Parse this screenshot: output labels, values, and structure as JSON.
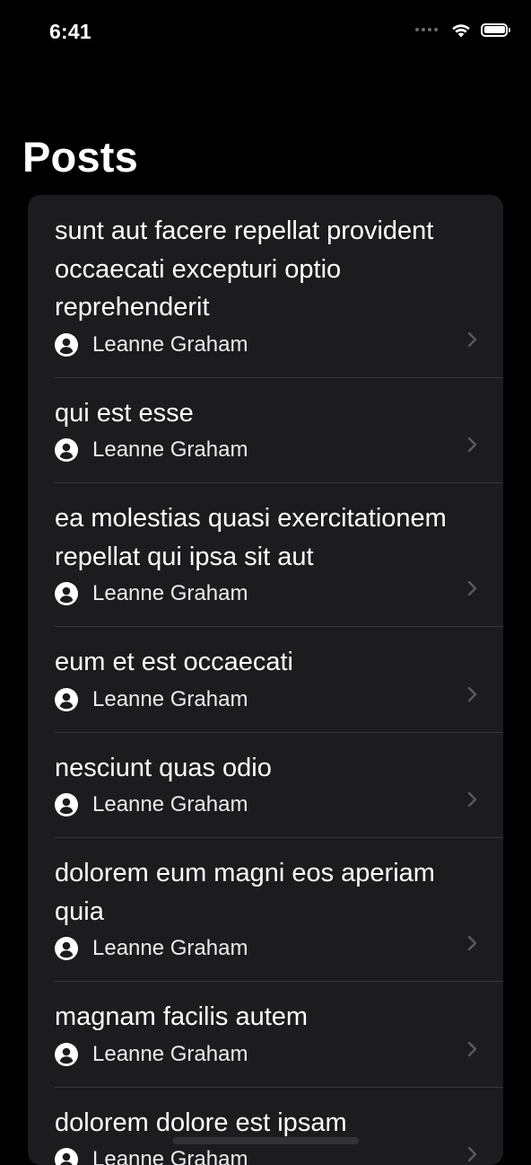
{
  "status_bar": {
    "time": "6:41",
    "icons": [
      "signal-icon",
      "wifi-icon",
      "battery-icon"
    ]
  },
  "navigation": {
    "title": "Posts"
  },
  "colors": {
    "background": "#000000",
    "card": "#1c1c1e",
    "separator": "#38383a",
    "text": "#ffffff",
    "chevron": "#5a5a5f"
  },
  "posts": [
    {
      "title": "sunt aut facere repellat provident occaecati excepturi optio reprehenderit",
      "author": "Leanne Graham"
    },
    {
      "title": "qui est esse",
      "author": "Leanne Graham"
    },
    {
      "title": "ea molestias quasi exercitationem repellat qui ipsa sit aut",
      "author": "Leanne Graham"
    },
    {
      "title": "eum et est occaecati",
      "author": "Leanne Graham"
    },
    {
      "title": "nesciunt quas odio",
      "author": "Leanne Graham"
    },
    {
      "title": "dolorem eum magni eos aperiam quia",
      "author": "Leanne Graham"
    },
    {
      "title": "magnam facilis autem",
      "author": "Leanne Graham"
    },
    {
      "title": "dolorem dolore est ipsam",
      "author": "Leanne Graham"
    }
  ]
}
